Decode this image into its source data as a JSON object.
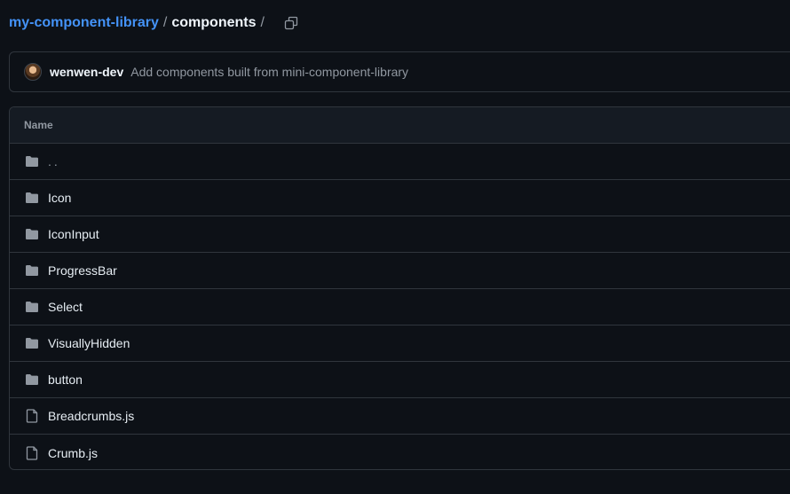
{
  "breadcrumb": {
    "repo": "my-component-library",
    "separator": "/",
    "current": "components",
    "trailing_separator": "/"
  },
  "copy_icon": "copy-icon",
  "commit": {
    "author": "wenwen-dev",
    "message": "Add components built from mini-component-library"
  },
  "table": {
    "header": "Name",
    "rows": [
      {
        "name": "..",
        "type": "folder"
      },
      {
        "name": "Icon",
        "type": "folder"
      },
      {
        "name": "IconInput",
        "type": "folder"
      },
      {
        "name": "ProgressBar",
        "type": "folder"
      },
      {
        "name": "Select",
        "type": "folder"
      },
      {
        "name": "VisuallyHidden",
        "type": "folder"
      },
      {
        "name": "button",
        "type": "folder"
      },
      {
        "name": "Breadcrumbs.js",
        "type": "file"
      },
      {
        "name": "Crumb.js",
        "type": "file"
      }
    ]
  },
  "colors": {
    "background": "#0d1117",
    "link": "#4493f8",
    "border": "#30363d",
    "muted": "#9198a1",
    "folder_icon": "#9198a1"
  }
}
